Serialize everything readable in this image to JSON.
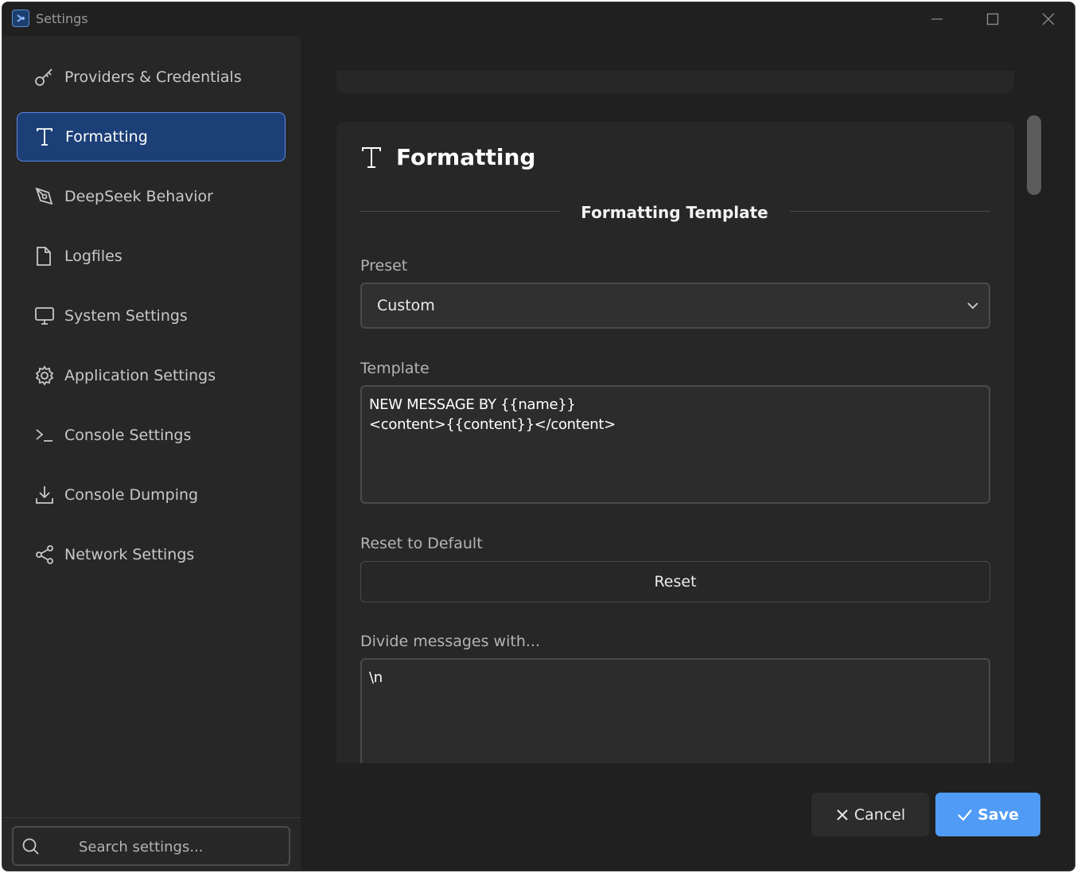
{
  "window": {
    "title": "Settings",
    "app_icon": "app-logo-icon"
  },
  "sidebar": {
    "items": [
      {
        "label": "Providers & Credentials",
        "icon": "key-icon",
        "active": false
      },
      {
        "label": "Formatting",
        "icon": "text-format-icon",
        "active": true
      },
      {
        "label": "DeepSeek Behavior",
        "icon": "pen-tool-icon",
        "active": false
      },
      {
        "label": "Logfiles",
        "icon": "file-icon",
        "active": false
      },
      {
        "label": "System Settings",
        "icon": "monitor-icon",
        "active": false
      },
      {
        "label": "Application Settings",
        "icon": "gear-icon",
        "active": false
      },
      {
        "label": "Console Settings",
        "icon": "terminal-icon",
        "active": false
      },
      {
        "label": "Console Dumping",
        "icon": "download-icon",
        "active": false
      },
      {
        "label": "Network Settings",
        "icon": "share-icon",
        "active": false
      }
    ],
    "search": {
      "placeholder": "Search settings..."
    }
  },
  "main": {
    "card_title": "Formatting",
    "section_title": "Formatting Template",
    "preset": {
      "label": "Preset",
      "value": "Custom"
    },
    "template": {
      "label": "Template",
      "lines": [
        "NEW MESSAGE BY {{name}}",
        "<content>{{content}}</content>"
      ]
    },
    "reset": {
      "label": "Reset to Default",
      "button": "Reset"
    },
    "divider": {
      "label": "Divide messages with...",
      "value": "\\n"
    }
  },
  "footer": {
    "cancel_label": "Cancel",
    "save_label": "Save"
  },
  "colors": {
    "accent": "#4f9bf5",
    "active_nav_bg": "#1c3f77",
    "active_nav_border": "#5a8ae6",
    "background": "#202020",
    "card": "#272727"
  }
}
